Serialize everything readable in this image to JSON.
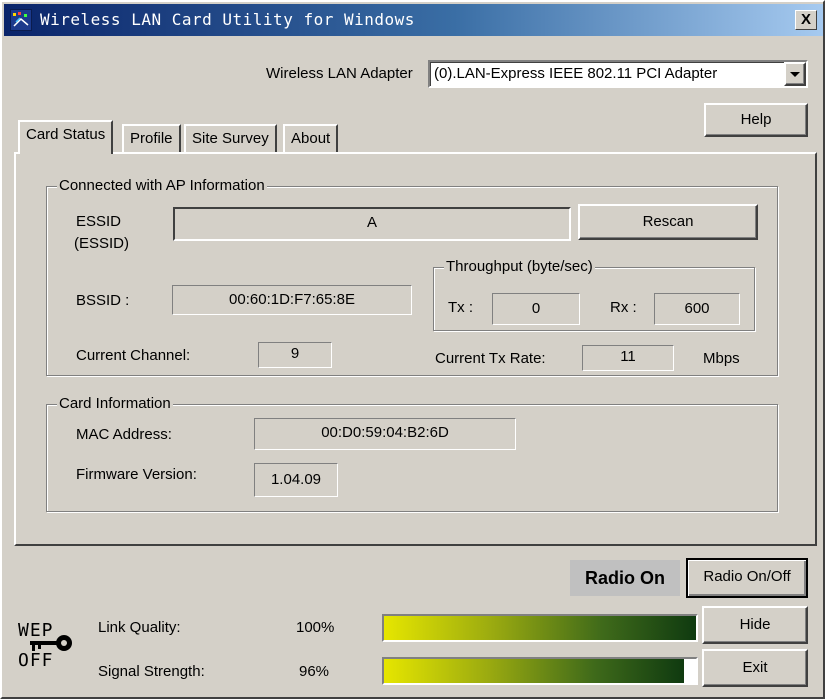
{
  "window": {
    "title": "Wireless LAN Card Utility for Windows",
    "close_label": "X"
  },
  "adapter": {
    "label": "Wireless LAN Adapter",
    "selected": "(0).LAN-Express IEEE 802.11 PCI Adapter"
  },
  "help_label": "Help",
  "tabs": [
    {
      "label": "Card Status"
    },
    {
      "label": "Profile"
    },
    {
      "label": "Site Survey"
    },
    {
      "label": "About"
    }
  ],
  "ap_info": {
    "legend": "Connected with AP Information",
    "essid_label": "ESSID",
    "essid_label2": "(ESSID)",
    "essid_value": "A",
    "rescan_label": "Rescan",
    "bssid_label": "BSSID :",
    "bssid_value": "00:60:1D:F7:65:8E",
    "channel_label": "Current Channel:",
    "channel_value": "9",
    "throughput": {
      "legend": "Throughput (byte/sec)",
      "tx_label": "Tx :",
      "tx_value": "0",
      "rx_label": "Rx :",
      "rx_value": "600"
    },
    "txrate_label": "Current Tx Rate:",
    "txrate_value": "11",
    "txrate_unit": "Mbps"
  },
  "card_info": {
    "legend": "Card Information",
    "mac_label": "MAC Address:",
    "mac_value": "00:D0:59:04:B2:6D",
    "fw_label": "Firmware Version:",
    "fw_value": "1.04.09"
  },
  "radio": {
    "status": "Radio On",
    "toggle_label": "Radio On/Off"
  },
  "wep": {
    "line1": "WEP",
    "line2": "OFF"
  },
  "link_quality": {
    "label": "Link Quality:",
    "value": "100%",
    "fraction": 1.0
  },
  "signal_strength": {
    "label": "Signal Strength:",
    "value": "96%",
    "fraction": 0.96
  },
  "hide_label": "Hide",
  "exit_label": "Exit",
  "colors": {
    "titlebar_start": "#0a246a",
    "titlebar_end": "#a6caf0",
    "face": "#d4d0c8"
  }
}
